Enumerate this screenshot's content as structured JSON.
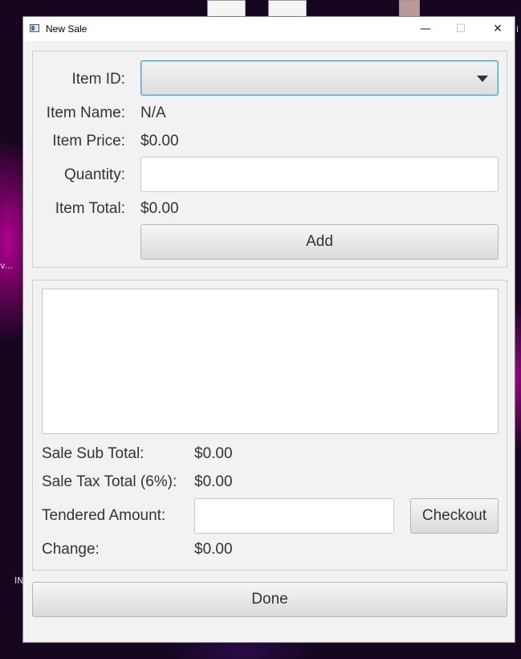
{
  "window": {
    "title": "New Sale",
    "minimize_glyph": "—",
    "maximize_glyph": "☐",
    "close_glyph": "✕"
  },
  "item_form": {
    "item_id_label": "Item ID:",
    "item_id_value": "",
    "item_name_label": "Item Name:",
    "item_name_value": "N/A",
    "item_price_label": "Item Price:",
    "item_price_value": "$0.00",
    "quantity_label": "Quantity:",
    "quantity_value": "",
    "item_total_label": "Item Total:",
    "item_total_value": "$0.00",
    "add_button": "Add"
  },
  "sale": {
    "items": [],
    "sub_total_label": "Sale Sub Total:",
    "sub_total_value": "$0.00",
    "tax_label": "Sale Tax Total (6%):",
    "tax_value": "$0.00",
    "tendered_label": "Tendered Amount:",
    "tendered_value": "",
    "checkout_button": "Checkout",
    "change_label": "Change:",
    "change_value": "$0.00"
  },
  "done_button": "Done",
  "desktop": {
    "left_text": "v...",
    "left_text_2": "IN",
    "right_text": "i"
  },
  "colors": {
    "accent": "#3aa3e0",
    "window_bg": "#f2f2f2"
  }
}
